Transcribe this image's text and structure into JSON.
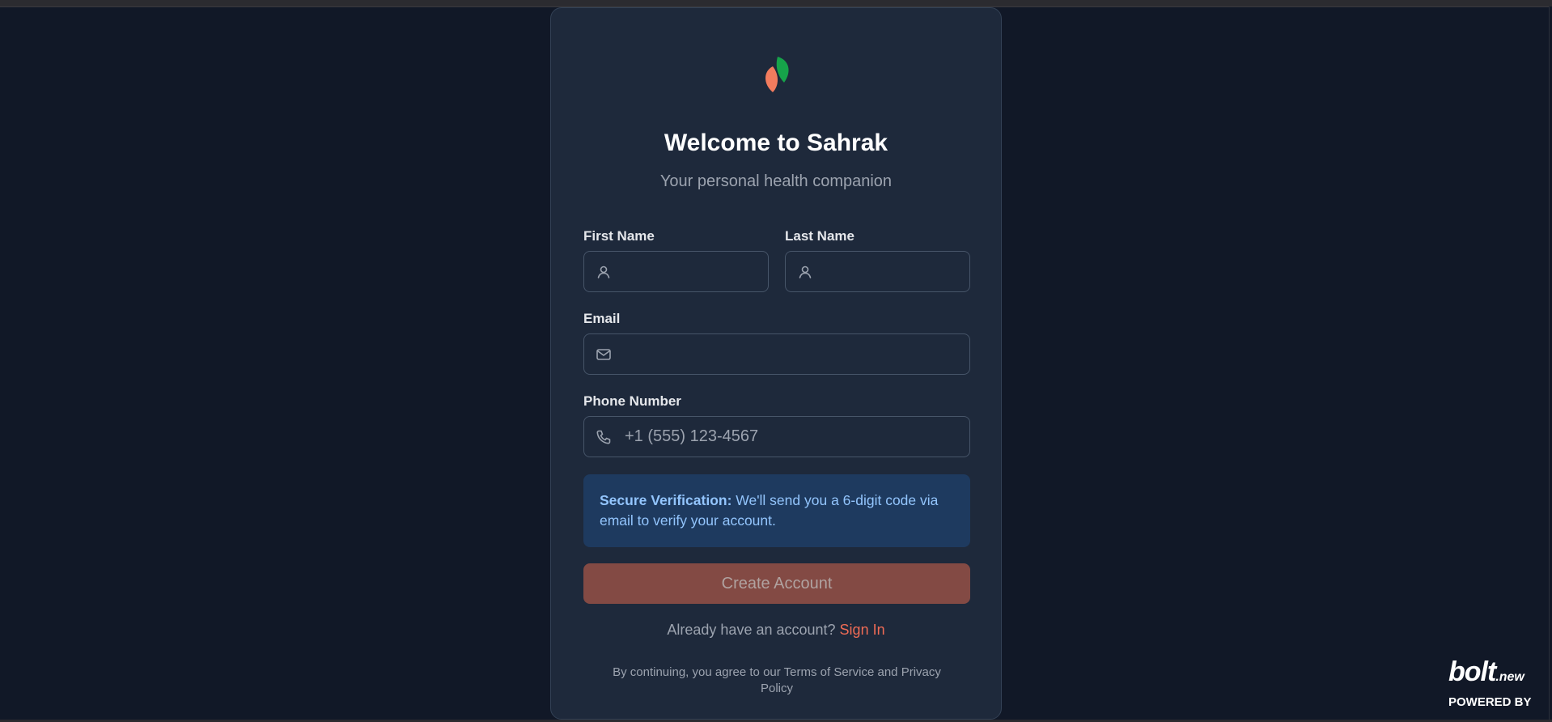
{
  "app": {
    "title": "Welcome to Sahrak",
    "subtitle": "Your personal health companion"
  },
  "form": {
    "first_name": {
      "label": "First Name",
      "value": "",
      "placeholder": "",
      "icon": "user-icon"
    },
    "last_name": {
      "label": "Last Name",
      "value": "",
      "placeholder": "",
      "icon": "user-icon"
    },
    "email": {
      "label": "Email",
      "value": "",
      "placeholder": "",
      "icon": "mail-icon"
    },
    "phone": {
      "label": "Phone Number",
      "value": "",
      "placeholder": "+1 (555) 123-4567",
      "icon": "phone-icon"
    }
  },
  "notice": {
    "title": "Secure Verification:",
    "text": " We'll send you a 6-digit code via email to verify your account."
  },
  "actions": {
    "create_label": "Create Account",
    "signin_prompt": "Already have an account? ",
    "signin_link": "Sign In"
  },
  "legal": "By continuing, you agree to our Terms of Service and Privacy Policy",
  "badge": {
    "brand": "bolt",
    "suffix": ".new",
    "powered_by": "POWERED BY"
  },
  "colors": {
    "background": "#111827",
    "card": "#1e293b",
    "accent": "#ef6b55",
    "button_disabled": "#834a44",
    "notice_bg": "#1e3a5f",
    "notice_text": "#93c5fd",
    "leaf_green": "#16a34a",
    "leaf_orange": "#f27c5e"
  }
}
